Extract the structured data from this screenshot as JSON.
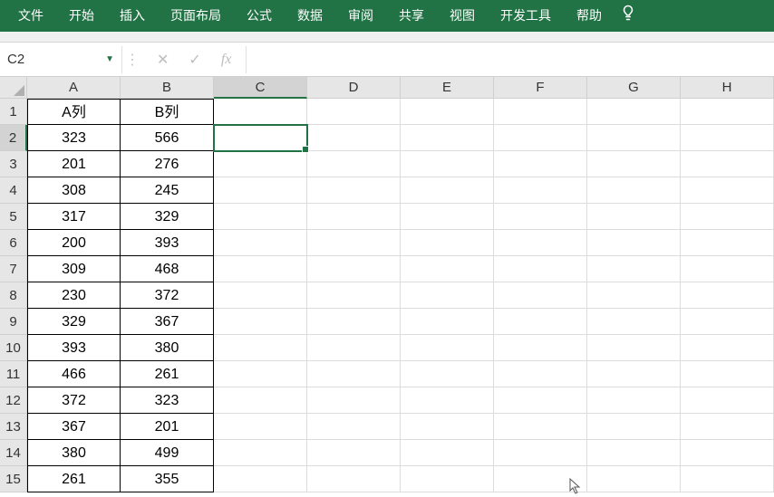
{
  "ribbon": {
    "tabs": [
      "文件",
      "开始",
      "插入",
      "页面布局",
      "公式",
      "数据",
      "审阅",
      "共享",
      "视图",
      "开发工具",
      "帮助"
    ]
  },
  "nameBox": {
    "value": "C2"
  },
  "formula": {
    "fxLabel": "fx",
    "value": ""
  },
  "columns": [
    "A",
    "B",
    "C",
    "D",
    "E",
    "F",
    "G",
    "H"
  ],
  "selected": {
    "row": 2,
    "col": "C"
  },
  "chart_data": {
    "type": "table",
    "headers": [
      "A列",
      "B列"
    ],
    "rows": [
      [
        323,
        566
      ],
      [
        201,
        276
      ],
      [
        308,
        245
      ],
      [
        317,
        329
      ],
      [
        200,
        393
      ],
      [
        309,
        468
      ],
      [
        230,
        372
      ],
      [
        329,
        367
      ],
      [
        393,
        380
      ],
      [
        466,
        261
      ],
      [
        372,
        323
      ],
      [
        367,
        201
      ],
      [
        380,
        499
      ],
      [
        261,
        355
      ]
    ]
  }
}
